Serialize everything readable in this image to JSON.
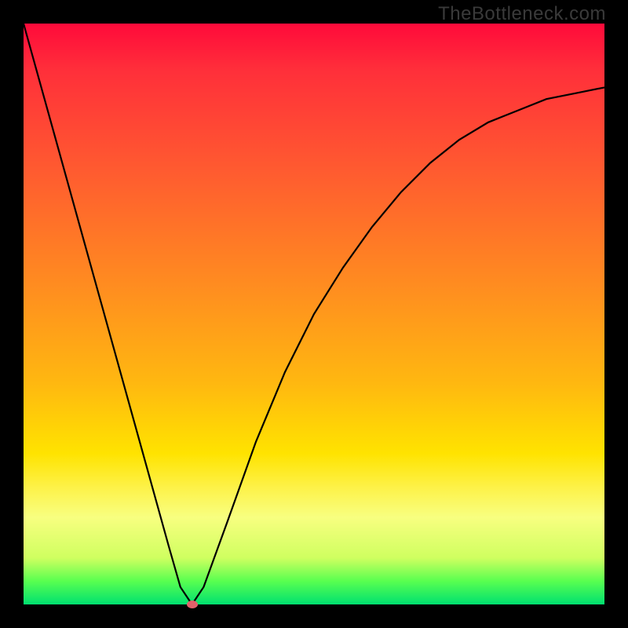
{
  "watermark": "TheBottleneck.com",
  "chart_data": {
    "type": "line",
    "title": "",
    "xlabel": "",
    "ylabel": "",
    "xlim": [
      0,
      100
    ],
    "ylim": [
      0,
      100
    ],
    "grid": false,
    "background_gradient": {
      "orientation": "vertical",
      "stops": [
        {
          "pos": 0.0,
          "color": "#ff0a3a"
        },
        {
          "pos": 0.25,
          "color": "#ff5a30"
        },
        {
          "pos": 0.5,
          "color": "#ff9a18"
        },
        {
          "pos": 0.75,
          "color": "#ffe300"
        },
        {
          "pos": 0.92,
          "color": "#cfff60"
        },
        {
          "pos": 1.0,
          "color": "#00e070"
        }
      ]
    },
    "series": [
      {
        "name": "bottleneck-curve",
        "color": "#000000",
        "x": [
          0,
          5,
          10,
          15,
          20,
          25,
          27,
          29,
          31,
          35,
          40,
          45,
          50,
          55,
          60,
          65,
          70,
          75,
          80,
          85,
          90,
          95,
          100
        ],
        "values": [
          100,
          82,
          64,
          46,
          28,
          10,
          3,
          0,
          3,
          14,
          28,
          40,
          50,
          58,
          65,
          71,
          76,
          80,
          83,
          85,
          87,
          88,
          89
        ]
      }
    ],
    "annotations": [
      {
        "type": "point",
        "name": "minimum-marker",
        "x": 29,
        "y": 0,
        "color": "#e0606a"
      }
    ]
  }
}
